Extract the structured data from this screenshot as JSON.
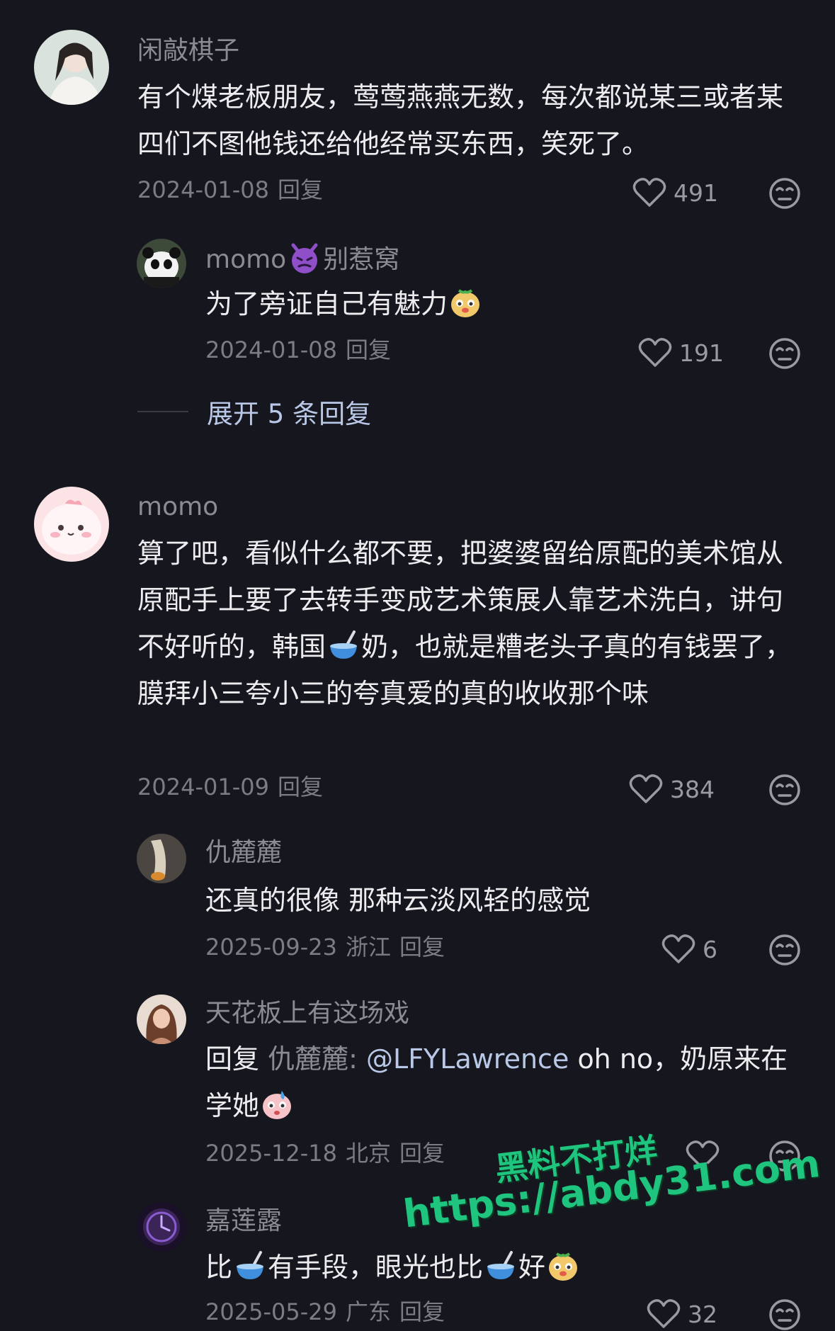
{
  "comments": [
    {
      "username": "闲敲棋子",
      "text": "有个煤老板朋友，莺莺燕燕无数，每次都说某三或者某四们不图他钱还给他经常买东西，笑死了。",
      "date": "2024-01-08",
      "reply_label": "回复",
      "likes": "491",
      "replies": [
        {
          "username": "momo",
          "username_suffix": "别惹窝",
          "text": "为了旁证自己有魅力",
          "date": "2024-01-08",
          "reply_label": "回复",
          "likes": "191"
        }
      ],
      "expand_label": "展开 5 条回复"
    },
    {
      "username": "momo",
      "text_parts": [
        "算了吧，看似什么都不要，把婆婆留给原配的美术馆从原配手上要了去转手变成艺术策展人靠艺术洗白，讲句不好听的，韩国",
        "奶，也就是糟老头子真的有钱罢了，膜拜小三夸小三的夸真爱的真的收收那个味"
      ],
      "date": "2024-01-09",
      "reply_label": "回复",
      "likes": "384",
      "replies": [
        {
          "username": "仇麓麓",
          "text": "还真的很像 那种云淡风轻的感觉",
          "date": "2025-09-23",
          "location": "浙江",
          "reply_label": "回复",
          "likes": "6"
        },
        {
          "username": "天花板上有这场戏",
          "reply_prefix": "回复",
          "reply_to": "仇麓麓",
          "mention": "@LFYLawrence",
          "text": "oh no，奶原来在学她",
          "date": "2025-12-18",
          "location": "北京",
          "reply_label": "回复"
        },
        {
          "username": "嘉莲露",
          "text_parts": [
            "比",
            "有手段，眼光也比",
            "好"
          ],
          "date": "2025-05-29",
          "location": "广东",
          "reply_label": "回复",
          "likes": "32"
        }
      ]
    }
  ],
  "watermark": {
    "line1": "黑料不打烊",
    "line2": "https://abdy31.com"
  },
  "colors": {
    "background": "#16161e",
    "username": "#8b8b92",
    "link": "#b8c8e6",
    "watermark": "#1fc47e"
  }
}
